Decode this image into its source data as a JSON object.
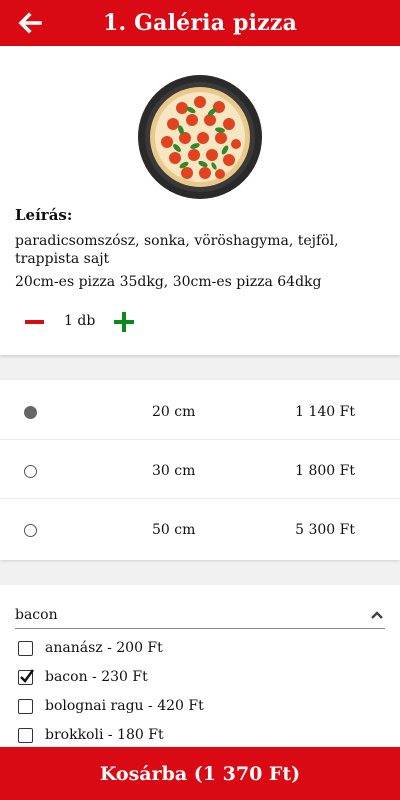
{
  "header": {
    "title": "1. Galéria pizza",
    "back_icon": "arrow-left-icon"
  },
  "product": {
    "image_icon": "pizza-image",
    "description_title": "Leírás:",
    "description": "paradicsomszósz, sonka, vöröshagyma, tejföl, trappista sajt",
    "size_info": "20cm-es pizza 35dkg, 30cm-es pizza 64dkg",
    "quantity": "1 db"
  },
  "sizes": [
    {
      "label": "20 cm",
      "price": "1 140 Ft",
      "selected": true
    },
    {
      "label": "30 cm",
      "price": "1 800 Ft",
      "selected": false
    },
    {
      "label": "50 cm",
      "price": "5 300 Ft",
      "selected": false
    }
  ],
  "extras": {
    "selected_value": "bacon",
    "items": [
      {
        "label": "ananász - 200 Ft",
        "checked": false
      },
      {
        "label": "bacon - 230 Ft",
        "checked": true
      },
      {
        "label": "bolognai ragu - 420 Ft",
        "checked": false
      },
      {
        "label": "brokkoli - 180 Ft",
        "checked": false
      }
    ]
  },
  "cart_button": {
    "label": "Kosárba (1 370 Ft)"
  },
  "colors": {
    "brand_red": "#d90a14",
    "plus_green": "#0a8a1a"
  }
}
